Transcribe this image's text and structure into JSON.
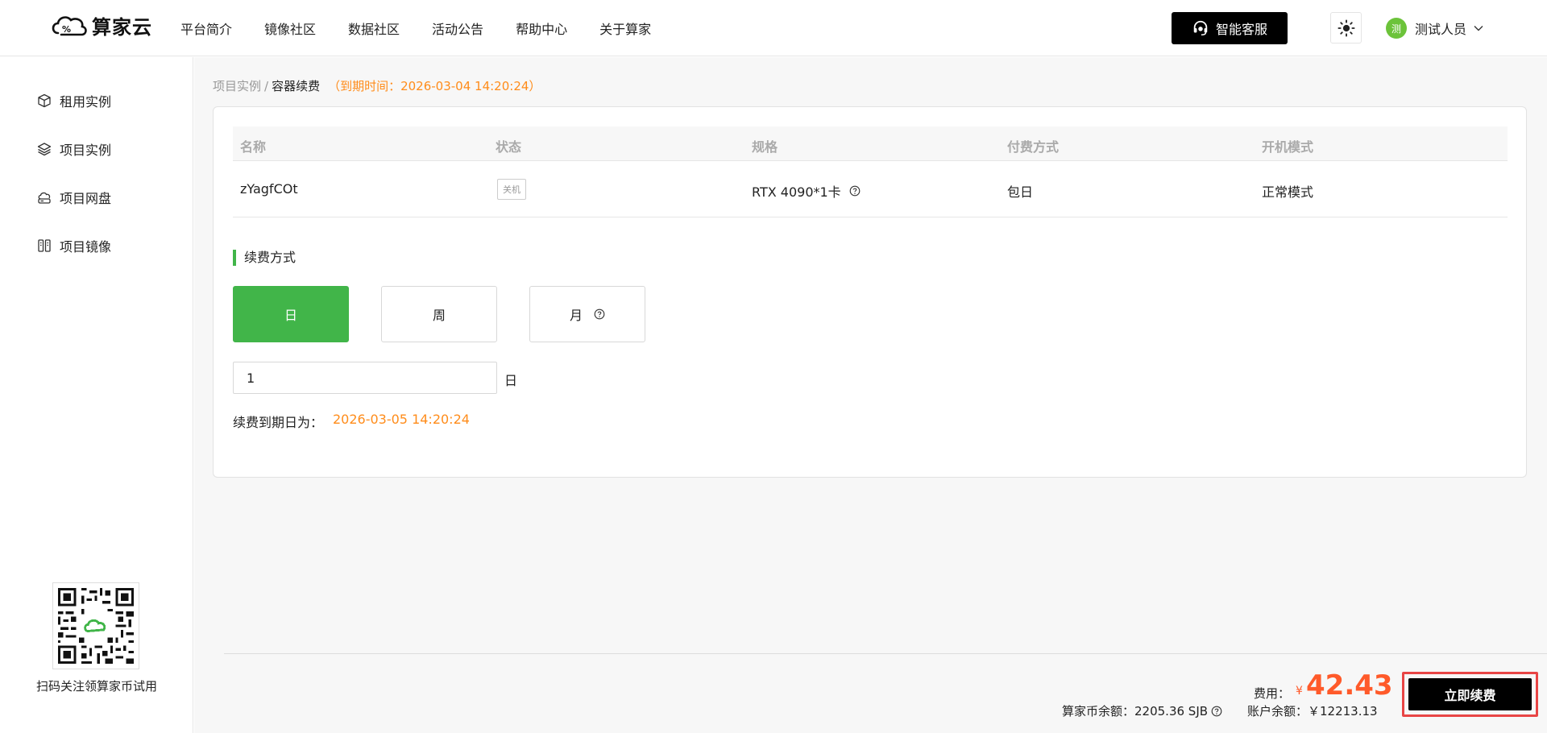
{
  "header": {
    "logo_text": "算家云",
    "nav": [
      "平台简介",
      "镜像社区",
      "数据社区",
      "活动公告",
      "帮助中心",
      "关于算家"
    ],
    "service_label": "智能客服",
    "user_avatar": "测",
    "user_name": "测试人员"
  },
  "sidebar": {
    "items": [
      {
        "label": "租用实例",
        "icon": "cube-icon"
      },
      {
        "label": "项目实例",
        "icon": "layers-icon"
      },
      {
        "label": "项目网盘",
        "icon": "cloud-disk-icon"
      },
      {
        "label": "项目镜像",
        "icon": "mirror-icon"
      }
    ],
    "qr_caption": "扫码关注领算家币试用"
  },
  "breadcrumb": {
    "parent": "项目实例",
    "separator": "/",
    "current": "容器续费",
    "expire_note": "（到期时间：2026-03-04 14:20:24）"
  },
  "table": {
    "columns": [
      "名称",
      "状态",
      "规格",
      "付费方式",
      "开机模式"
    ],
    "row": {
      "name": "zYagfCOt",
      "status": "关机",
      "spec": "RTX 4090*1卡",
      "billing": "包日",
      "boot_mode": "正常模式"
    }
  },
  "renew": {
    "section_title": "续费方式",
    "options": [
      "日",
      "周",
      "月"
    ],
    "selected": "日",
    "quantity": "1",
    "quantity_unit": "日",
    "expire_label": "续费到期日为：",
    "expire_value": "2026-03-05 14:20:24"
  },
  "footer": {
    "fee_label": "费用：",
    "currency": "¥",
    "fee_amount": "42.43",
    "coins_text": "算家币余额：2205.36 SJB",
    "balance_text": "账户余额：￥12213.13",
    "renew_button": "立即续费"
  },
  "colors": {
    "accent_green": "#41b549",
    "orange": "#ff8c1a",
    "price_red": "#ff5a2a",
    "highlight_border": "#e84545"
  }
}
